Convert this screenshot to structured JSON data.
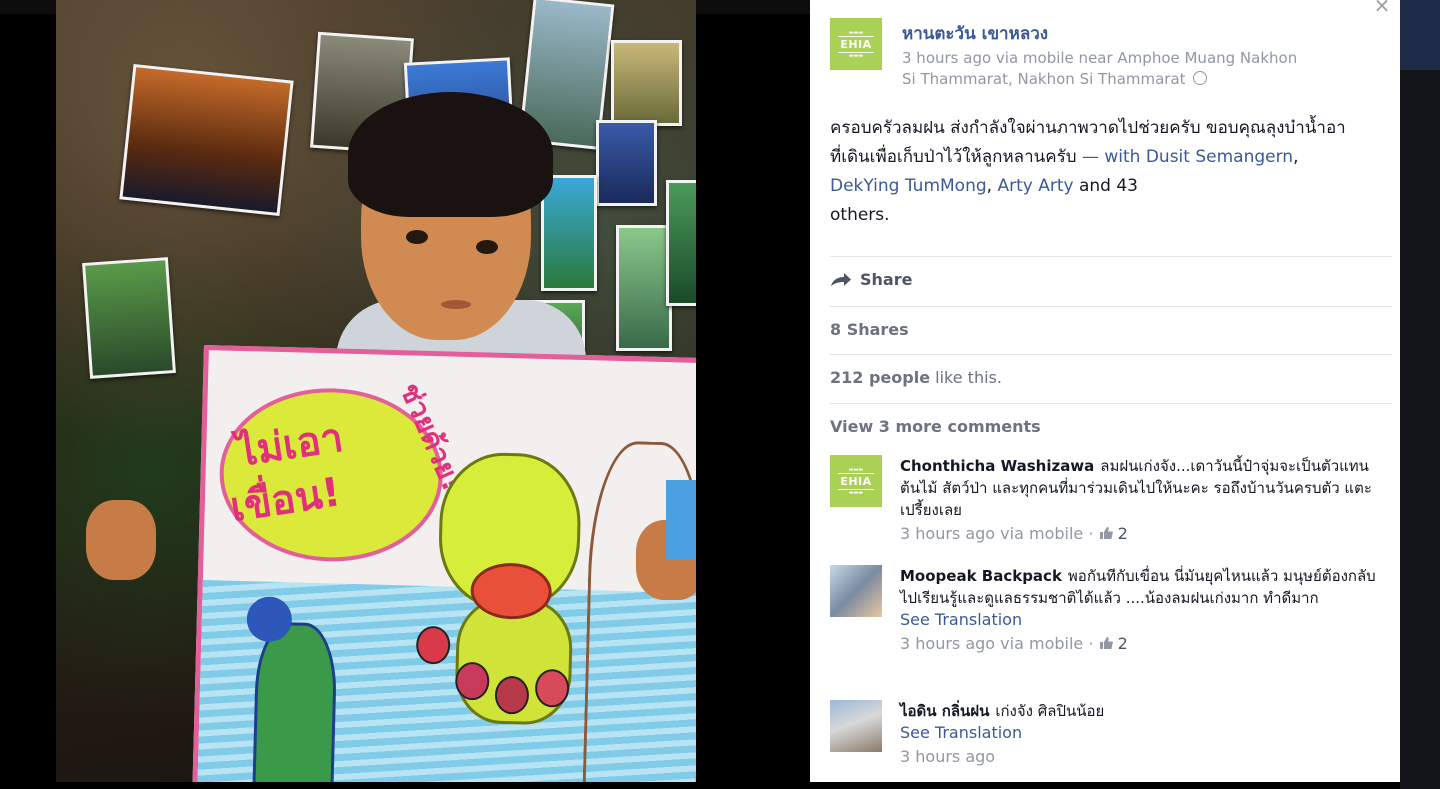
{
  "post": {
    "author": "หานตะวัน เขาหลวง",
    "avatar_text": "EHIA",
    "meta_line1": "3 hours ago via mobile near Amphoe Muang Nakhon",
    "meta_line2": "Si Thammarat, Nakhon Si Thammarat",
    "text_main": "ครอบครัวลมฝน ส่งกำลังใจผ่านภาพวาดไปช่วยครับ ขอบคุณลุงบ๋าน้ำอาที่เดินเพื่อเก็บป่าไว้ให้ลูกหลานครับ",
    "with_prefix": " — with ",
    "tag1": "Dusit Semangern",
    "sep1": ", ",
    "tag2": "DekYing TumMong",
    "sep2": ", ",
    "tag3": "Arty Arty",
    "and_text": " and ",
    "others_count": "43",
    "others_suffix": "others."
  },
  "actions": {
    "share_label": "Share",
    "shares_count": "8 Shares",
    "likes_count": "212 people",
    "likes_suffix": " like this.",
    "view_more": "View 3 more comments"
  },
  "comments": [
    {
      "name": "Chonthicha Washizawa",
      "text": "ลมฝนเก่งจัง...เดาวันนี้ป๋าจุ่มจะเป็นตัวแทนต้นไม้ สัตว์ป่า และทุกคนที่มาร่วมเดินไปให้นะคะ รอถึงบ้านวันครบตัว แตะเปรี้ยงเลย",
      "time": "3 hours ago via mobile · ",
      "likes": "2",
      "avatar_text": "EHIA"
    },
    {
      "name": "Moopeak Backpack",
      "text": "พอกันทีกับเขื่อน นี่มันยุคไหนแล้ว มนุษย์ต้องกลับไปเรียนรู้และดูแลธรรมชาติได้แล้ว ....น้องลมฝนเก่งมาก ทำดีมาก",
      "see_translation": "See Translation",
      "time": "3 hours ago via mobile · ",
      "likes": "2"
    },
    {
      "name": "ไอดิน กลิ่นฝน",
      "text": "เก่งจัง ศิลปินน้อย",
      "see_translation": "See Translation",
      "time": "3 hours ago"
    }
  ],
  "close_label": "×",
  "poster": {
    "text_line1": "ไม่เอา",
    "text_line2": "เขื่อน!",
    "text_side": "ช่วยด้วย!"
  },
  "colors": {
    "link": "#3b5998",
    "meta": "#9197a3",
    "brand_green": "#a9d155"
  }
}
